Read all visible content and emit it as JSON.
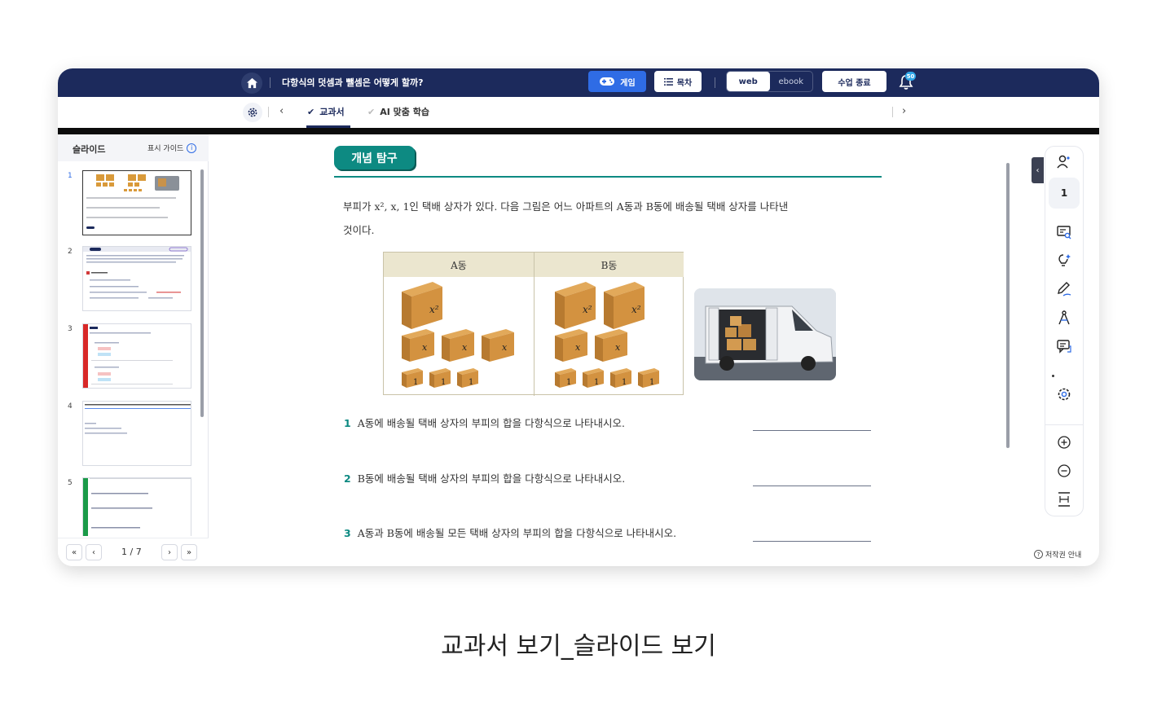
{
  "header": {
    "lesson_title": "다항식의 덧셈과 뺄셈은 어떻게 할까?",
    "game_label": "게임",
    "toc_label": "목차",
    "view_web": "web",
    "view_ebook": "ebook",
    "end_class_label": "수업 종료",
    "notification_count": "50"
  },
  "subnav": {
    "tabs": [
      {
        "label": "교과서",
        "active": true
      },
      {
        "label": "AI 맞춤 학습",
        "active": false
      }
    ]
  },
  "sidebar": {
    "title": "슬라이드",
    "guide_label": "표시 가이드",
    "slides": [
      {
        "num": "1"
      },
      {
        "num": "2"
      },
      {
        "num": "3"
      },
      {
        "num": "4"
      },
      {
        "num": "5"
      }
    ],
    "pager": {
      "current": "1",
      "total": "7",
      "text": "1 / 7"
    }
  },
  "content": {
    "badge": "개념 탐구",
    "intro_line1": "부피가 x², x, 1인 택배 상자가 있다. 다음 그림은 어느 아파트의 A동과 B동에 배송될 택배 상자를 나타낸",
    "intro_line2": "것이다.",
    "table": {
      "col_a": "A동",
      "col_b": "B동",
      "box_x2": "x²",
      "box_x": "x",
      "box_1": "1"
    },
    "questions": [
      {
        "num": "1",
        "text": "A동에 배송될 택배 상자의 부피의 합을 다항식으로 나타내시오."
      },
      {
        "num": "2",
        "text": "B동에 배송될 택배 상자의 부피의 합을 다항식으로 나타내시오."
      },
      {
        "num": "3",
        "text": "A동과 B동에 배송될 모든 택배 상자의 부피의 합을 다항식으로 나타내시오."
      }
    ]
  },
  "toolbar": {
    "page_number": "1",
    "icons": [
      "user-icon",
      "screen-search-icon",
      "lightbulb-icon",
      "pen-icon",
      "compass-icon",
      "chat-icon",
      "gear-icon",
      "zoom-in-icon",
      "zoom-out-icon",
      "fit-height-icon"
    ],
    "copyright_label": "저작권 안내"
  },
  "caption": "교과서 보기_슬라이드 보기",
  "colors": {
    "navy": "#1c2a5c",
    "accent_blue": "#2f6ce5",
    "teal": "#0d8a82"
  }
}
